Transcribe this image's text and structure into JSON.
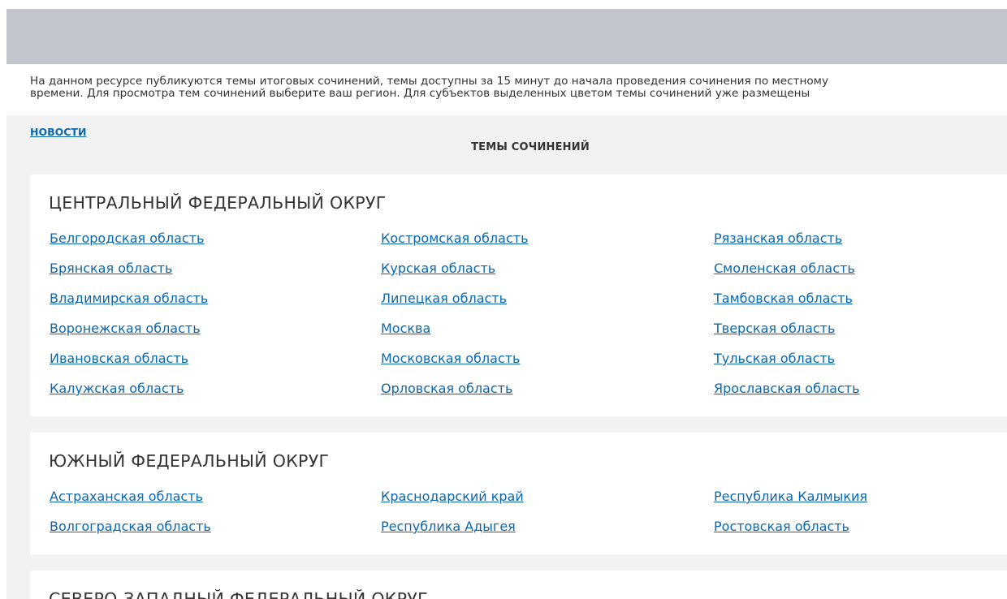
{
  "intro": {
    "line1": "На данном ресурсе публикуются темы итоговых сочинений, темы доступны за 15 минут до начала проведения сочинения по местному",
    "line2": "времени. Для просмотра тем сочинений выберите ваш регион. Для субъектов выделенных цветом темы сочинений уже размещены"
  },
  "nav": {
    "news_label": "НОВОСТИ"
  },
  "section_title": "ТЕМЫ СОЧИНЕНИЙ",
  "districts": [
    {
      "title": "ЦЕНТРАЛЬНЫЙ ФЕДЕРАЛЬНЫЙ ОКРУГ",
      "columns": [
        [
          "Белгородская область",
          "Брянская область",
          "Владимирская область",
          "Воронежская область",
          "Ивановская область",
          "Калужская область"
        ],
        [
          "Костромская область",
          "Курская область",
          "Липецкая область",
          "Москва",
          "Московская область",
          "Орловская область"
        ],
        [
          "Рязанская область",
          "Смоленская область",
          "Тамбовская область",
          "Тверская область",
          "Тульская область",
          "Ярославская область"
        ]
      ]
    },
    {
      "title": "ЮЖНЫЙ ФЕДЕРАЛЬНЫЙ ОКРУГ",
      "columns": [
        [
          "Астраханская область",
          "Волгоградская область"
        ],
        [
          "Краснодарский край",
          "Республика Адыгея"
        ],
        [
          "Республика Калмыкия",
          "Ростовская область"
        ]
      ]
    },
    {
      "title": "СЕВЕРО-ЗАПАДНЫЙ ФЕДЕРАЛЬНЫЙ ОКРУГ",
      "columns": [
        [],
        [],
        []
      ]
    }
  ],
  "colors": {
    "banner": "#c2c5cc",
    "content_background": "#f2f2f2",
    "link": "#0a67b0",
    "text": "#333333"
  }
}
